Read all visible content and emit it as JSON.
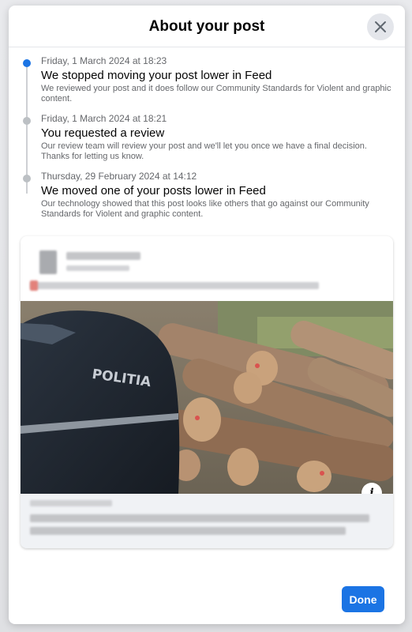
{
  "modal": {
    "title": "About your post",
    "close_icon": "close-icon",
    "done_label": "Done"
  },
  "timeline": [
    {
      "date": "Friday, 1 March 2024 at 18:23",
      "heading": "We stopped moving your post lower in Feed",
      "description": "We reviewed your post and it does follow our Community Standards for Violent and graphic content.",
      "active": true
    },
    {
      "date": "Friday, 1 March 2024 at 18:21",
      "heading": "You requested a review",
      "description": "Our review team will review your post and we'll let you once we have a final decision. Thanks for letting us know.",
      "active": false
    },
    {
      "date": "Thursday, 29 February 2024 at 14:12",
      "heading": "We moved one of your posts lower in Feed",
      "description": "Our technology showed that this post looks like others that go against our Community Standards for Violent and graphic content.",
      "active": false
    }
  ],
  "post": {
    "jacket_text": "POLITIA",
    "info_icon": "info-icon"
  },
  "colors": {
    "accent": "#1b74e4",
    "inactive_dot": "#bcc0c4"
  }
}
